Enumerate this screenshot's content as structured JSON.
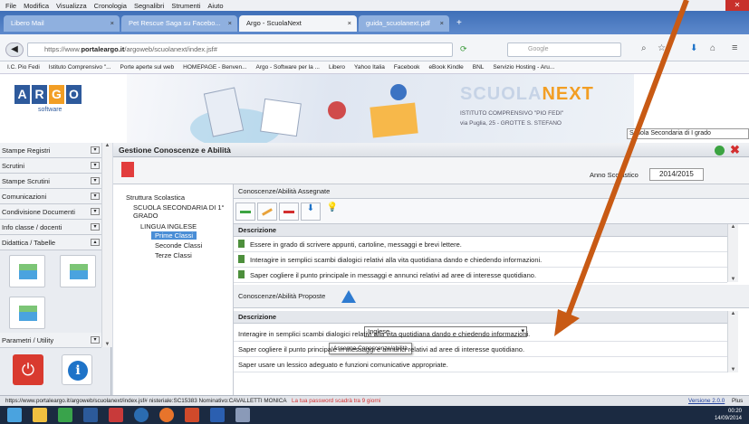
{
  "menu": [
    "File",
    "Modifica",
    "Visualizza",
    "Cronologia",
    "Segnalibri",
    "Strumenti",
    "Aiuto"
  ],
  "tabs": [
    {
      "label": "Libero Mail",
      "active": false
    },
    {
      "label": "Pet Rescue Saga su Facebo...",
      "active": false
    },
    {
      "label": "Argo - ScuolaNext",
      "active": true
    },
    {
      "label": "guida_scuolanext.pdf",
      "active": false
    }
  ],
  "address": {
    "url_prefix": "https://www.",
    "url_domain": "portaleargo.it",
    "url_path": "/argoweb/scuolanext/index.jsf#",
    "search_placeholder": "Google"
  },
  "bookmarks": [
    "I.C. Pio Fedi",
    "Istituto Comprensivo \"...",
    "Porte aperte sul web",
    "HOMEPAGE - Benven...",
    "Argo - Software per la ...",
    "Libero",
    "Yahoo Italia",
    "Facebook",
    "eBook Kindle",
    "BNL",
    "Servizio Hosting - Aru..."
  ],
  "banner": {
    "logo_letters": [
      "A",
      "R",
      "G",
      "O"
    ],
    "logo_sub": "software",
    "sn_a": "SCUOLA",
    "sn_b": "NEXT",
    "school_line1": "ISTITUTO COMPRENSIVO \"PIO FEDI\"",
    "school_line2": "via Puglia, 25 - GROTTE S. STEFANO",
    "school_select": "Scuola Secondaria di I grado"
  },
  "sidebar": {
    "items": [
      "Stampe Registri",
      "Scrutini",
      "Stampe Scrutini",
      "Comunicazioni",
      "Condivisione Documenti",
      "Info classe / docenti",
      "Didattica / Tabelle"
    ],
    "param": "Parametri / Utility"
  },
  "main": {
    "title": "Gestione Conoscenze e Abilità",
    "anno_label": "Anno Scolastico",
    "anno_value": "2014/2015",
    "tree": {
      "root": "Struttura Scolastica",
      "school": "SCUOLA SECONDARIA DI 1°",
      "school2": "GRADO",
      "subject": "LINGUA INGLESE",
      "classes": [
        "Prime Classi",
        "Seconde Classi",
        "Terze Classi"
      ]
    },
    "assigned": {
      "header": "Conoscenze/Abilità Assegnate",
      "col": "Descrizione",
      "rows": [
        "Essere in grado di scrivere appunti, cartoline, messaggi e brevi lettere.",
        "Interagire in semplici scambi dialogici relativi alla vita quotidiana dando e chiedendo informazioni.",
        "Saper cogliere il punto principale in messaggi e annunci relativi ad aree di interesse quotidiano."
      ]
    },
    "proposed": {
      "header": "Conoscenze/Abilità Proposte",
      "select": "Inglese",
      "tooltip": "Assegna Conoscenze/abilità",
      "col": "Descrizione",
      "rows": [
        "Interagire in semplici scambi dialogici relativi alla vita quotidiana dando e chiedendo informazioni.",
        "Saper cogliere il punto principale in messaggi e annunci relativi ad aree di interesse quotidiano.",
        "Saper usare un lessico adeguato e funzioni comunicative appropriate."
      ]
    }
  },
  "status": {
    "left": "https://www.portaleargo.it/argoweb/scuolanext/index.jsf#  nisteriale:SC15383 Nominativo:CAVALLETTI MONICA",
    "warn": "La tua password scadrà tra 9 giorni",
    "version": "Versione 2.0.0",
    "plus": "Plus"
  },
  "clock": {
    "time": "00:20",
    "date": "14/09/2014"
  },
  "colors": {
    "accent": "#2e5a9c",
    "orange": "#f29e24",
    "arrow": "#c85a14"
  }
}
